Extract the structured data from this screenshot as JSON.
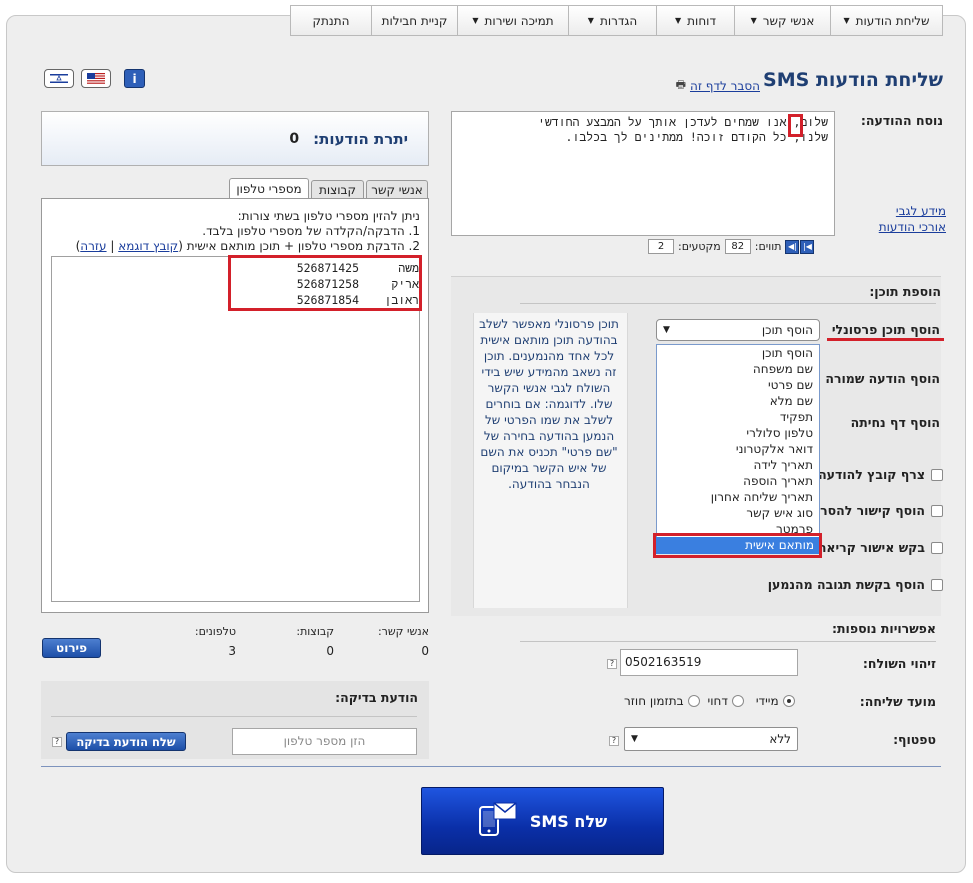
{
  "nav": {
    "items": [
      {
        "label": "שליחת הודעות",
        "dropdown": true
      },
      {
        "label": "אנשי קשר",
        "dropdown": true
      },
      {
        "label": "דוחות",
        "dropdown": true
      },
      {
        "label": "הגדרות",
        "dropdown": true
      },
      {
        "label": "תמיכה ושירות",
        "dropdown": true
      },
      {
        "label": "קניית חבילות",
        "dropdown": false
      },
      {
        "label": "התנתק",
        "dropdown": false
      }
    ]
  },
  "page": {
    "title": "שליחת הודעות SMS",
    "explain_link": "הסבר לדף זה"
  },
  "message": {
    "label": "נוסח ההודעה:",
    "text_line1": "שלום, אנו שמחים לעדכן אותך על המבצע החודשי",
    "text_line2": "שלנו, כל הקודם זוכה! ממתינים לך בכלבו.",
    "info_link1": "מידע לגבי",
    "info_link2": "אורכי הודעות",
    "chars_label": "תווים:",
    "chars_value": "82",
    "segments_label": "מקטעים:",
    "segments_value": "2"
  },
  "balance": {
    "label": "יתרת הודעות:",
    "value": "0"
  },
  "tabs": [
    {
      "label": "אנשי קשר",
      "active": false
    },
    {
      "label": "קבוצות",
      "active": false
    },
    {
      "label": "מספרי טלפון",
      "active": true
    }
  ],
  "recipients": {
    "instructions_line1": "ניתן להזין מספרי טלפון בשתי צורות:",
    "instructions_line2": "1. הדבקה/הקלדה של מספרי טלפון בלבד.",
    "instructions_line3": "2. הדבקת מספרי טלפון + תוכן מותאם אישית",
    "sample_link": "קובץ דוגמא",
    "help_link": "עזרה",
    "entries": [
      {
        "phone": "526871425",
        "name": "משה"
      },
      {
        "phone": "526871258",
        "name": "אריק"
      },
      {
        "phone": "526871854",
        "name": "ראובן"
      }
    ]
  },
  "counts": {
    "contacts_label": "אנשי קשר:",
    "contacts_value": "0",
    "groups_label": "קבוצות:",
    "groups_value": "0",
    "phones_label": "טלפונים:",
    "phones_value": "3",
    "details_button": "פירוט"
  },
  "add_content": {
    "label": "הוספת תוכן:",
    "personal_label": "הוסף תוכן פרסונלי",
    "saved_label": "הוסף הודעה שמורה",
    "landing_label": "הוסף דף נחיתה",
    "attach_label": "צרף קובץ להודעה",
    "link_label": "הוסף קישור להסרה",
    "confirm_label": "בקש אישור קריאה",
    "reply_label": "הוסף בקשת תגובה מהנמען",
    "select_value": "הוסף תוכן",
    "dropdown_options": [
      "הוסף תוכן",
      "שם משפחה",
      "שם פרטי",
      "שם מלא",
      "תפקיד",
      "טלפון סלולרי",
      "דואר אלקטרוני",
      "תאריך לידה",
      "תאריך הוספה",
      "תאריך שליחה אחרון",
      "סוג איש קשר",
      "פרמטר",
      "מותאם אישית"
    ],
    "selected_option": "מותאם אישית",
    "tooltip": "תוכן פרסונלי מאפשר לשלב בהודעה תוכן מותאם אישית לכל אחד מהנמענים. תוכן זה נשאב מהמידע שיש בידי השולח לגבי אנשי הקשר שלו. לדוגמה: אם בוחרים לשלב את שמו הפרטי של הנמען בהודעה בחירה של \"שם פרטי\" תכניס את השם של איש הקשר במיקום הנבחר בהודעה."
  },
  "options": {
    "label": "אפשרויות נוספות:",
    "sender_label": "זיהוי השולח:",
    "sender_value": "0502163519",
    "timing_label": "מועד שליחה:",
    "timing_options": [
      {
        "label": "מיידי",
        "checked": true
      },
      {
        "label": "דחוי",
        "checked": false
      },
      {
        "label": "בתזמון חוזר",
        "checked": false
      }
    ],
    "flash_label": "טפטוף:",
    "flash_value": "ללא"
  },
  "test": {
    "label": "הודעת בדיקה:",
    "placeholder": "הזן מספר טלפון",
    "button": "שלח הודעת בדיקה"
  },
  "send": {
    "button": "שלח SMS"
  },
  "colors": {
    "title": "#1f3f73",
    "highlight_red": "#d3202a",
    "selected_blue": "#3a7fe0",
    "send_button": "#0b32b8"
  }
}
